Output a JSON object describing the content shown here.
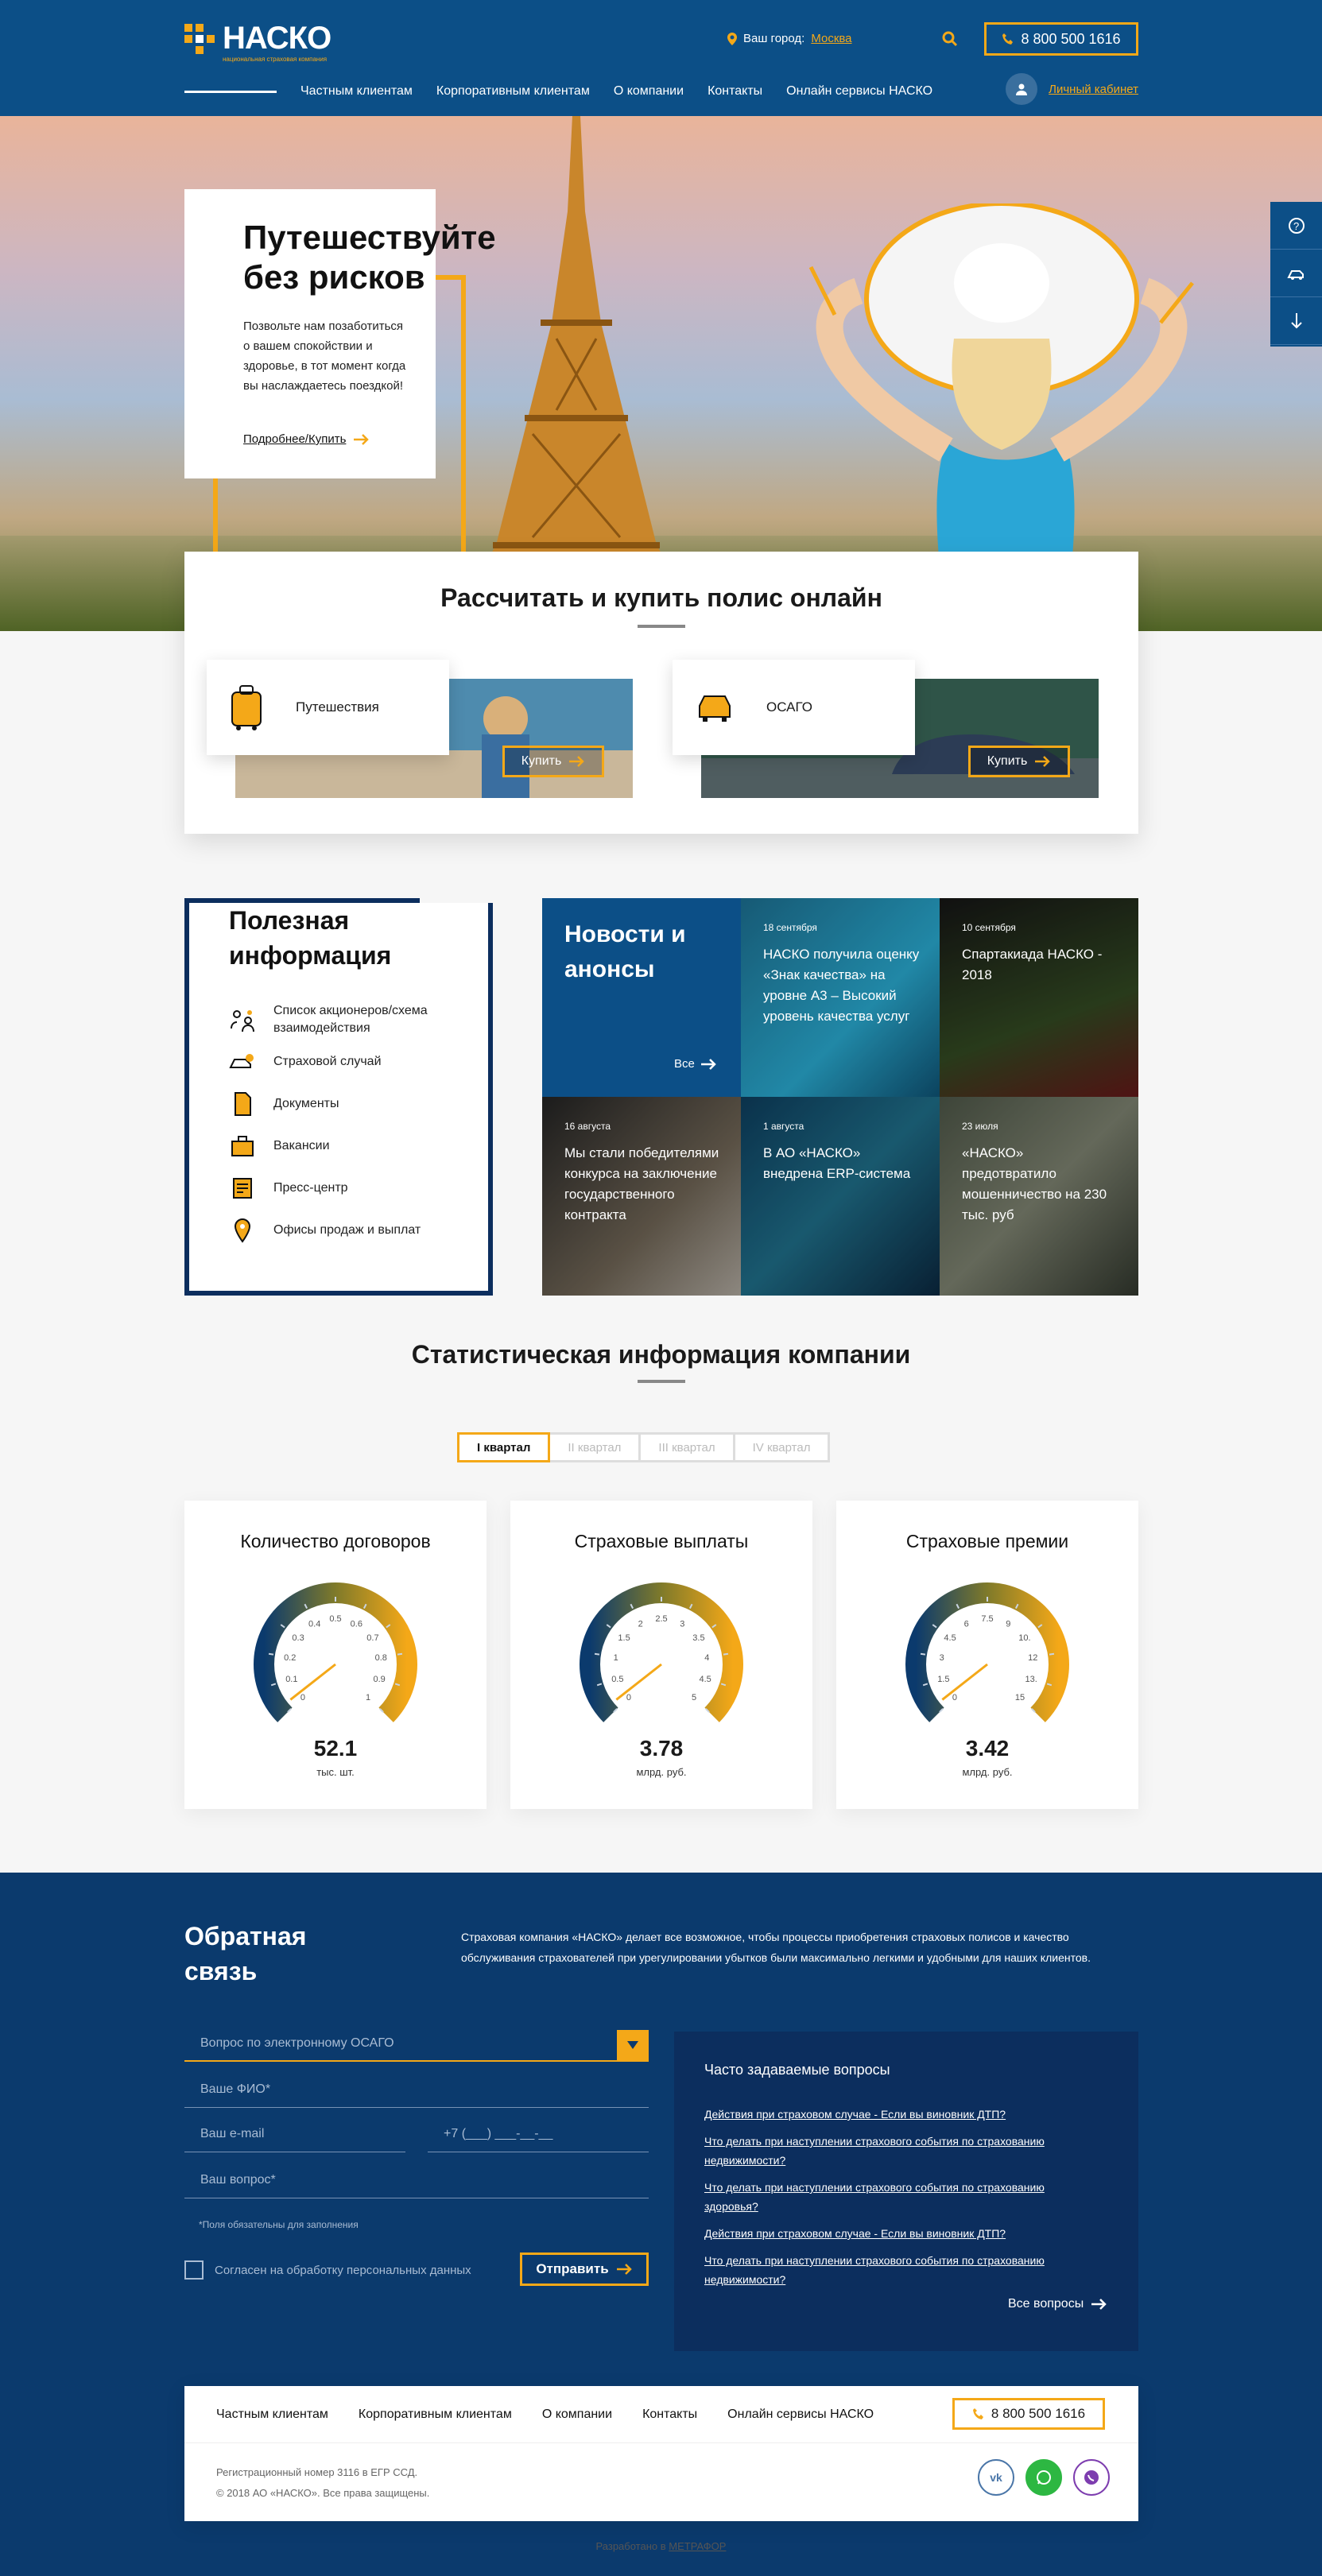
{
  "header": {
    "brand": "НАСКО",
    "tagline": "национальная страховая компания",
    "city_label": "Ваш город:",
    "city_value": "Москва",
    "phone": "8 800 500 1616",
    "nav": [
      "Частным клиентам",
      "Корпоративным клиентам",
      "О компании",
      "Контакты",
      "Онлайн сервисы НАСКО"
    ],
    "cabinet": "Личный кабинет"
  },
  "hero": {
    "title": "Путешествуйте без рисков",
    "text": "Позвольте нам позаботиться о вашем спокойствии и здоровье, в тот момент когда вы наслаждаетесь поездкой!",
    "link": "Подробнее/Купить"
  },
  "calc": {
    "title": "Рассчитать и купить полис онлайн",
    "products": [
      {
        "label": "Путешествия",
        "button": "Купить"
      },
      {
        "label": "ОСАГО",
        "button": "Купить"
      }
    ]
  },
  "info": {
    "title": "Полезная информация",
    "items": [
      "Список акционеров/схема взаимодействия",
      "Страховой случай",
      "Документы",
      "Вакансии",
      "Пресс-центр",
      "Офисы продаж и выплат"
    ]
  },
  "news": {
    "title": "Новости и анонсы",
    "all": "Все",
    "items": [
      {
        "date": "18 сентября",
        "text": "НАСКО получила оценку «Знак качества» на уровне А3 – Высокий уровень качества услуг"
      },
      {
        "date": "10 сентября",
        "text": "Спартакиада НАСКО - 2018"
      },
      {
        "date": "16 августа",
        "text": "Мы стали победителями конкурса на заключение государственного контракта"
      },
      {
        "date": "1 августа",
        "text": "В АО «НАСКО» внедрена ERP-система"
      },
      {
        "date": "23 июля",
        "text": "«НАСКО» предотвратило мошенничество на 230 тыс. руб"
      }
    ]
  },
  "stats": {
    "title": "Статистическая информация компании",
    "tabs": [
      "I квартал",
      "II квартал",
      "III квартал",
      "IV квартал"
    ],
    "cards": [
      {
        "title": "Количество договоров",
        "value": "52.1",
        "unit": "тыс. шт.",
        "ticks": [
          "0",
          "0.1",
          "0.2",
          "0.3",
          "0.4",
          "0.5",
          "0.6",
          "0.7",
          "0.8",
          "0.9",
          "1"
        ]
      },
      {
        "title": "Страховые выплаты",
        "value": "3.78",
        "unit": "млрд. руб.",
        "ticks": [
          "0",
          "0.5",
          "1",
          "1.5",
          "2",
          "2.5",
          "3",
          "3.5",
          "4",
          "4.5",
          "5"
        ]
      },
      {
        "title": "Страховые премии",
        "value": "3.42",
        "unit": "млрд. руб.",
        "ticks": [
          "0",
          "1.5",
          "3",
          "4.5",
          "6",
          "7.5",
          "9",
          "10.",
          "12",
          "13.",
          "15"
        ]
      }
    ]
  },
  "feedback": {
    "title": "Обратная связь",
    "lead": "Страховая компания «НАСКО» делает все возможное, чтобы процессы приобретения страховых полисов и качество обслуживания страхователей при урегулировании убытков были максимально легкими и удобными для наших клиентов.",
    "topic": "Вопрос по электронному ОСАГО",
    "name_ph": "Ваше ФИО*",
    "email_ph": "Ваш e-mail",
    "phone_ph": "+7 (___) ___-__-__",
    "question_ph": "Ваш вопрос*",
    "note": "*Поля обязательны для заполнения",
    "agree": "Согласен на обработку персональных данных",
    "send": "Отправить",
    "faq_title": "Часто задаваемые вопросы",
    "faq": [
      "Действия при страховом случае - Если вы виновник ДТП?",
      "Что делать при наступлении страхового события по страхованию недвижимости?",
      "Что делать при наступлении страхового события по страхованию здоровья?",
      "Действия при страховом случае - Если вы виновник ДТП?",
      "Что делать при наступлении страхового события по страхованию недвижимости?"
    ],
    "faq_all": "Все вопросы"
  },
  "footer": {
    "nav": [
      "Частным клиентам",
      "Корпоративным клиентам",
      "О компании",
      "Контакты",
      "Онлайн сервисы НАСКО"
    ],
    "phone": "8 800 500 1616",
    "reg": "Регистрационный номер 3116 в ЕГР ССД.",
    "copy": "© 2018 АО «НАСКО». Все права защищены.",
    "dev_label": "Разработано в",
    "dev_name": "МЕТРАФОР"
  },
  "colors": {
    "accent": "#f4a818",
    "brand": "#0c4f87",
    "dark": "#0b3a6d"
  }
}
